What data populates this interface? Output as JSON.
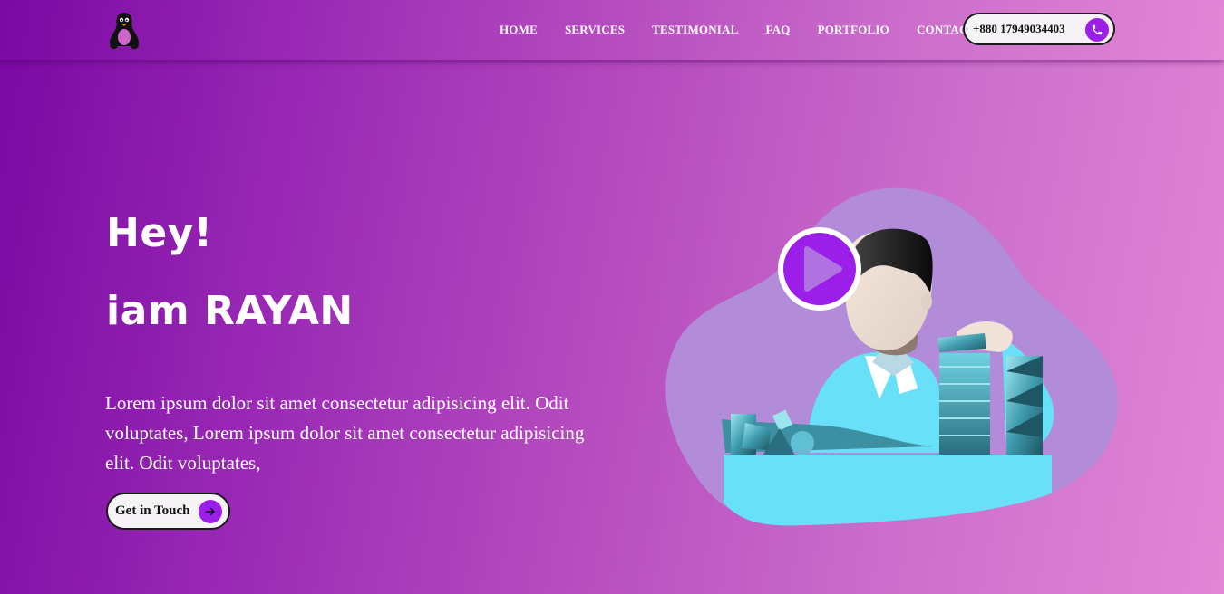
{
  "nav": {
    "logo_icon": "linux-penguin-icon",
    "links": [
      "HOME",
      "SERVICES",
      "TESTIMONIAL",
      "FAQ",
      "PORTFOLIO",
      "CONTACT"
    ],
    "phone": "+880 17949034403",
    "phone_icon": "phone-icon"
  },
  "hero": {
    "greeting": "Hey!",
    "name_line": "iam RAYAN",
    "paragraph": "Lorem ipsum dolor sit amet consectetur adipisicing elit. Odit voluptates, Lorem ipsum dolor sit amet consectetur adipisicing elit. Odit voluptates,",
    "cta_label": "Get in Touch",
    "cta_icon": "arrow-right-icon",
    "play_icon": "play-icon"
  },
  "colors": {
    "gradient_start": "#7a08a3",
    "gradient_end": "#e286d6",
    "accent": "#9b1fe8",
    "illustration_cyan": "#67e0f8",
    "blob": "#b28bd9"
  }
}
